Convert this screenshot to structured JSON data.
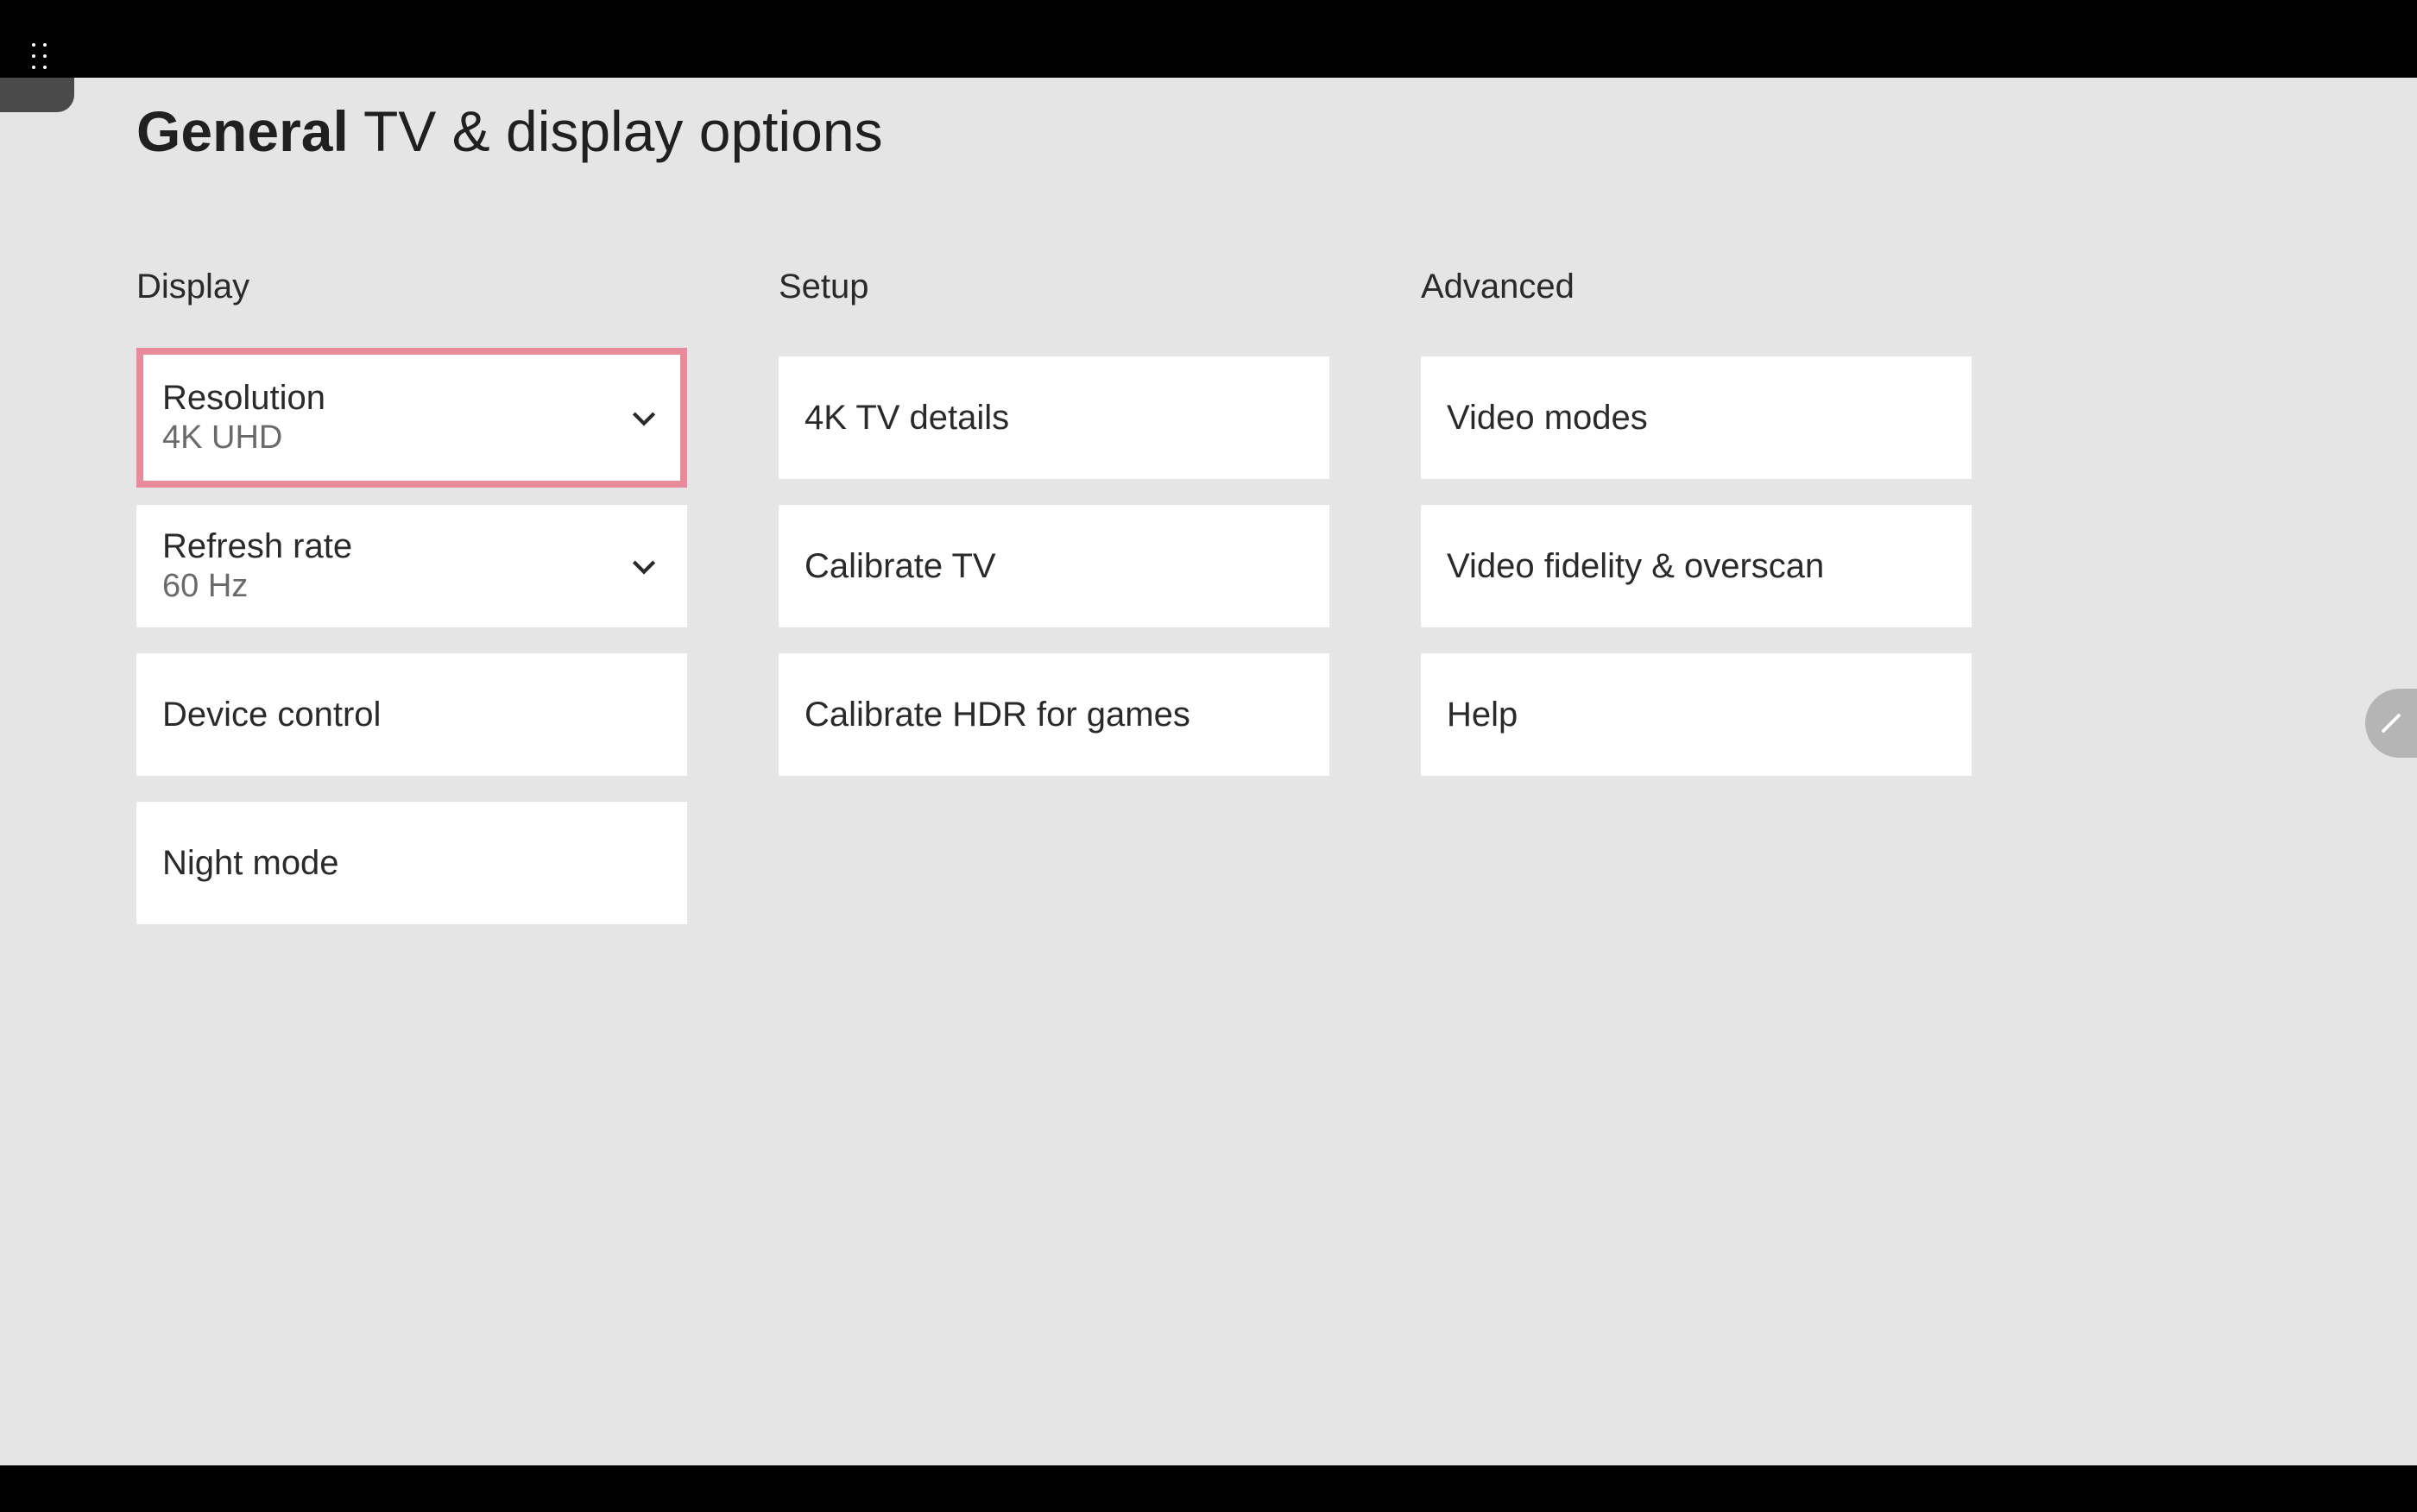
{
  "title": {
    "bold": "General",
    "light": "TV & display options"
  },
  "columns": {
    "display": {
      "header": "Display",
      "resolution": {
        "label": "Resolution",
        "value": "4K UHD"
      },
      "refresh_rate": {
        "label": "Refresh rate",
        "value": "60 Hz"
      },
      "device_control": "Device control",
      "night_mode": "Night mode"
    },
    "setup": {
      "header": "Setup",
      "tv_details": "4K TV details",
      "calibrate_tv": "Calibrate TV",
      "calibrate_hdr": "Calibrate HDR for games"
    },
    "advanced": {
      "header": "Advanced",
      "video_modes": "Video modes",
      "video_fidelity": "Video fidelity & overscan",
      "help": "Help"
    }
  }
}
